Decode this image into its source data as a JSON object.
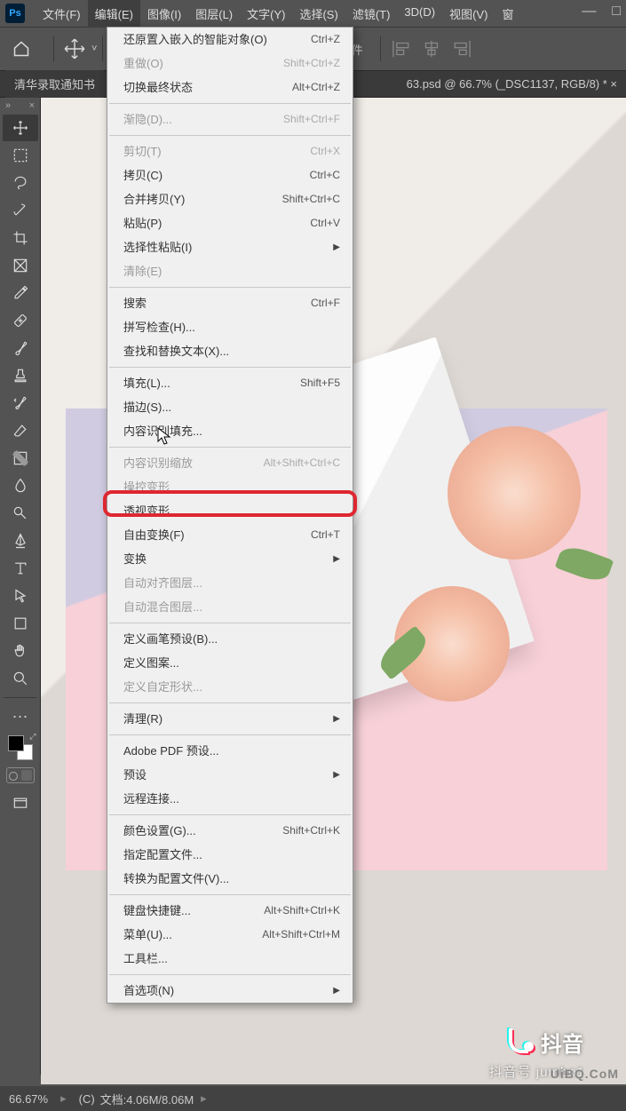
{
  "app": {
    "logo": "Ps"
  },
  "menubar": [
    "文件(F)",
    "编辑(E)",
    "图像(I)",
    "图层(L)",
    "文字(Y)",
    "选择(S)",
    "滤镜(T)",
    "3D(D)",
    "视图(V)",
    "窗"
  ],
  "active_menu_index": 1,
  "win": {
    "min": "—",
    "max": "□"
  },
  "options": {
    "ctrl_label": "控件"
  },
  "tabs": {
    "left": "清华录取通知书",
    "right": "63.psd @ 66.7% (_DSC1137, RGB/8) * ×"
  },
  "dropdown": {
    "groups": [
      [
        {
          "label": "还原置入嵌入的智能对象(O)",
          "sc": "Ctrl+Z",
          "enabled": true
        },
        {
          "label": "重做(O)",
          "sc": "Shift+Ctrl+Z",
          "enabled": false
        },
        {
          "label": "切换最终状态",
          "sc": "Alt+Ctrl+Z",
          "enabled": true
        }
      ],
      [
        {
          "label": "渐隐(D)...",
          "sc": "Shift+Ctrl+F",
          "enabled": false
        }
      ],
      [
        {
          "label": "剪切(T)",
          "sc": "Ctrl+X",
          "enabled": false
        },
        {
          "label": "拷贝(C)",
          "sc": "Ctrl+C",
          "enabled": true
        },
        {
          "label": "合并拷贝(Y)",
          "sc": "Shift+Ctrl+C",
          "enabled": true
        },
        {
          "label": "粘贴(P)",
          "sc": "Ctrl+V",
          "enabled": true
        },
        {
          "label": "选择性粘贴(I)",
          "sc": "",
          "enabled": true,
          "sub": true
        },
        {
          "label": "清除(E)",
          "sc": "",
          "enabled": false
        }
      ],
      [
        {
          "label": "搜索",
          "sc": "Ctrl+F",
          "enabled": true
        },
        {
          "label": "拼写检查(H)...",
          "sc": "",
          "enabled": true
        },
        {
          "label": "查找和替换文本(X)...",
          "sc": "",
          "enabled": true
        }
      ],
      [
        {
          "label": "填充(L)...",
          "sc": "Shift+F5",
          "enabled": true
        },
        {
          "label": "描边(S)...",
          "sc": "",
          "enabled": true
        },
        {
          "label": "内容识别填充...",
          "sc": "",
          "enabled": true
        }
      ],
      [
        {
          "label": "内容识别缩放",
          "sc": "Alt+Shift+Ctrl+C",
          "enabled": false
        },
        {
          "label": "操控变形",
          "sc": "",
          "enabled": false
        },
        {
          "label": "透视变形",
          "sc": "",
          "enabled": true
        },
        {
          "label": "自由变换(F)",
          "sc": "Ctrl+T",
          "enabled": true
        },
        {
          "label": "变换",
          "sc": "",
          "enabled": true,
          "sub": true
        },
        {
          "label": "自动对齐图层...",
          "sc": "",
          "enabled": false
        },
        {
          "label": "自动混合图层...",
          "sc": "",
          "enabled": false
        }
      ],
      [
        {
          "label": "定义画笔预设(B)...",
          "sc": "",
          "enabled": true
        },
        {
          "label": "定义图案...",
          "sc": "",
          "enabled": true
        },
        {
          "label": "定义自定形状...",
          "sc": "",
          "enabled": false
        }
      ],
      [
        {
          "label": "清理(R)",
          "sc": "",
          "enabled": true,
          "sub": true
        }
      ],
      [
        {
          "label": "Adobe PDF 预设...",
          "sc": "",
          "enabled": true
        },
        {
          "label": "预设",
          "sc": "",
          "enabled": true,
          "sub": true
        },
        {
          "label": "远程连接...",
          "sc": "",
          "enabled": true
        }
      ],
      [
        {
          "label": "颜色设置(G)...",
          "sc": "Shift+Ctrl+K",
          "enabled": true
        },
        {
          "label": "指定配置文件...",
          "sc": "",
          "enabled": true
        },
        {
          "label": "转换为配置文件(V)...",
          "sc": "",
          "enabled": true
        }
      ],
      [
        {
          "label": "键盘快捷键...",
          "sc": "Alt+Shift+Ctrl+K",
          "enabled": true
        },
        {
          "label": "菜单(U)...",
          "sc": "Alt+Shift+Ctrl+M",
          "enabled": true
        },
        {
          "label": "工具栏...",
          "sc": "",
          "enabled": true
        }
      ],
      [
        {
          "label": "首选项(N)",
          "sc": "",
          "enabled": true,
          "sub": true
        }
      ]
    ]
  },
  "statusbar": {
    "zoom": "66.67%",
    "doc": "文档:4.06M/8.06M"
  },
  "overlay": {
    "brand": "抖音",
    "subtitle": "抖音号 jumbo1",
    "watermark": "UiBQ.CoM"
  },
  "status_icon": "(C)"
}
